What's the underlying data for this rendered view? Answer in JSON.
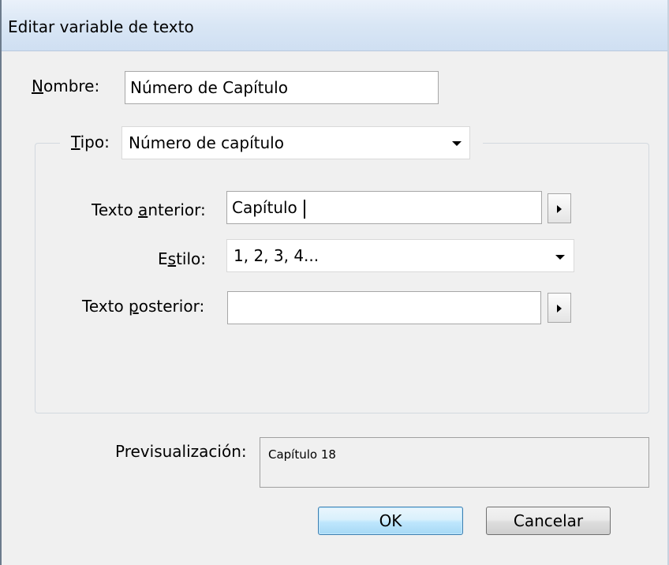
{
  "window": {
    "title": "Editar variable de texto"
  },
  "nombre": {
    "label_prefix": "",
    "label_mnemonic": "N",
    "label_rest": "ombre:",
    "value": "Número de Capítulo"
  },
  "tipo": {
    "label_mnemonic": "T",
    "label_rest": "ipo:",
    "value": "Número de capítulo"
  },
  "texto_anterior": {
    "label_start": "Texto ",
    "label_mnemonic": "a",
    "label_rest": "nterior:",
    "value": "Capítulo"
  },
  "estilo": {
    "label_start": "E",
    "label_mnemonic": "s",
    "label_rest": "tilo:",
    "value": "1, 2, 3, 4..."
  },
  "texto_posterior": {
    "label_start": "Texto ",
    "label_mnemonic": "p",
    "label_rest": "osterior:",
    "value": ""
  },
  "preview": {
    "label": "Previsualización:",
    "value": "Capítulo 18"
  },
  "buttons": {
    "ok": "OK",
    "cancel": "Cancelar"
  }
}
